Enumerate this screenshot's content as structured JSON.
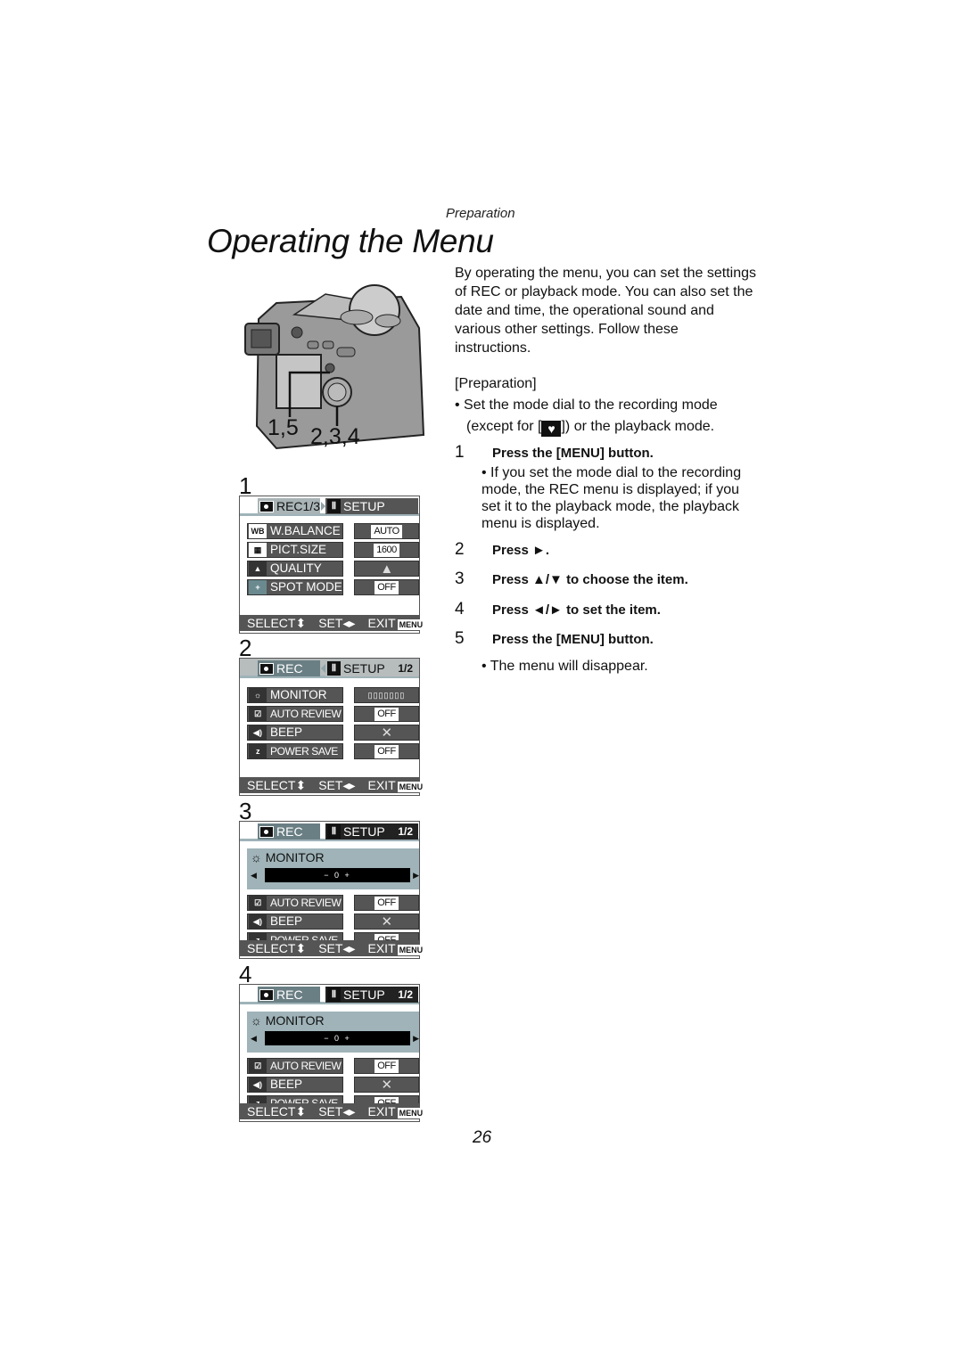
{
  "header": {
    "section": "Preparation",
    "title": "Operating the Menu"
  },
  "camera": {
    "label_left": "1,5",
    "label_right": "2,3,4"
  },
  "screens": [
    {
      "step": "1",
      "tab_rec": "REC1/3",
      "tab_setup": "SETUP",
      "page": "",
      "rows": [
        {
          "icon": "WB",
          "name": "W.BALANCE",
          "value": "AUTO"
        },
        {
          "icon": "▦",
          "name": "PICT.SIZE",
          "value": "1600"
        },
        {
          "icon": "▲",
          "name": "QUALITY",
          "value": "▲"
        },
        {
          "icon": "+",
          "name": "SPOT MODE",
          "value": "OFF"
        }
      ]
    },
    {
      "step": "2",
      "tab_rec": "REC",
      "tab_setup": "SETUP",
      "page": "1/2",
      "rows": [
        {
          "icon": "☼",
          "name": "MONITOR",
          "value": "▯▯▯▯▯▯▯"
        },
        {
          "icon": "☑",
          "name": "AUTO REVIEW",
          "value": "OFF"
        },
        {
          "icon": "◀)",
          "name": "BEEP",
          "value": "✕"
        },
        {
          "icon": "z",
          "name": "POWER SAVE",
          "value": "OFF"
        }
      ]
    },
    {
      "step": "3",
      "tab_rec": "REC",
      "tab_setup": "SETUP",
      "page": "1/2",
      "monitor": {
        "label": "MONITOR",
        "scale": "− 0 +",
        "level": 0
      },
      "rows": [
        {
          "icon": "☑",
          "name": "AUTO REVIEW",
          "value": "OFF"
        },
        {
          "icon": "◀)",
          "name": "BEEP",
          "value": "✕"
        },
        {
          "icon": "z",
          "name": "POWER SAVE",
          "value": "OFF"
        }
      ]
    },
    {
      "step": "4",
      "tab_rec": "REC",
      "tab_setup": "SETUP",
      "page": "1/2",
      "monitor": {
        "label": "MONITOR",
        "scale": "− 0 +",
        "level": 0
      },
      "rows": [
        {
          "icon": "☑",
          "name": "AUTO REVIEW",
          "value": "OFF"
        },
        {
          "icon": "◀)",
          "name": "BEEP",
          "value": "✕"
        },
        {
          "icon": "z",
          "name": "POWER SAVE",
          "value": "OFF"
        }
      ]
    }
  ],
  "footer": {
    "select": "SELECT",
    "set": "SET",
    "exit": "EXIT",
    "menu_badge": "MENU"
  },
  "body": {
    "intro": "By operating the menu, you can set the settings of REC or playback mode. You can also set the date and time, the operational sound and various other settings. Follow these instructions.",
    "prep_heading": "[Preparation]",
    "prep_bullet_a": "• Set the mode dial to the recording mode",
    "prep_bullet_b1": "(except for [",
    "prep_bullet_b2": "]) or the playback mode.",
    "steps": [
      {
        "num": "1",
        "text": "Press the [MENU] button."
      },
      {
        "num": "2",
        "text": "Press ►."
      },
      {
        "num": "3",
        "text": "Press ▲/▼ to choose the item."
      },
      {
        "num": "4",
        "text": "Press ◄/► to set the item."
      },
      {
        "num": "5",
        "text": "Press the [MENU] button."
      }
    ],
    "note_step1": "• If you set the mode dial to the recording mode, the REC menu is displayed; if you set it to the playback mode, the playback menu is displayed.",
    "note_step5": "• The menu will disappear."
  },
  "page_number": "26"
}
